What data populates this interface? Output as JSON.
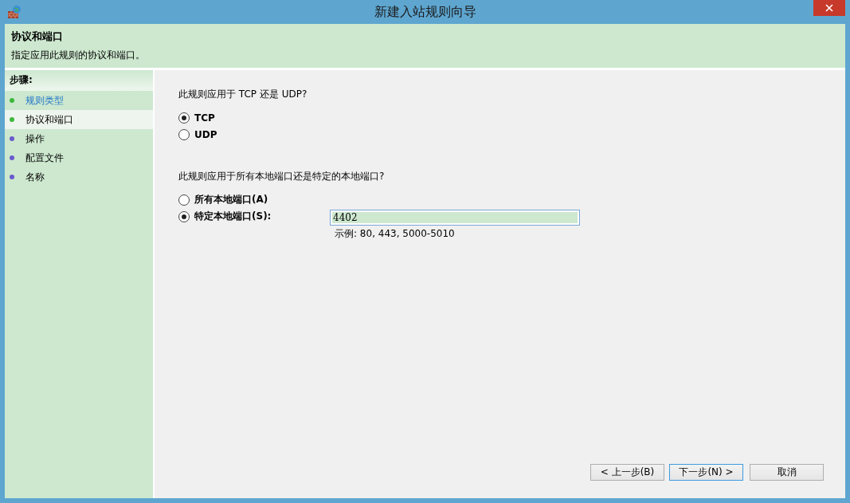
{
  "window": {
    "title": "新建入站规则向导"
  },
  "header": {
    "title": "协议和端口",
    "subtitle": "指定应用此规则的协议和端口。"
  },
  "steps": {
    "title": "步骤:",
    "items": [
      {
        "label": "规则类型",
        "color": "#3cb83c",
        "selected": false,
        "link": true
      },
      {
        "label": "协议和端口",
        "color": "#3cb83c",
        "selected": true,
        "link": false
      },
      {
        "label": "操作",
        "color": "#6a5acd",
        "selected": false,
        "link": false
      },
      {
        "label": "配置文件",
        "color": "#6a5acd",
        "selected": false,
        "link": false
      },
      {
        "label": "名称",
        "color": "#6a5acd",
        "selected": false,
        "link": false
      }
    ]
  },
  "protocol": {
    "question": "此规则应用于 TCP 还是 UDP?",
    "options": [
      {
        "label": "TCP",
        "selected": true
      },
      {
        "label": "UDP",
        "selected": false
      }
    ]
  },
  "ports": {
    "question": "此规则应用于所有本地端口还是特定的本地端口?",
    "options": [
      {
        "label": "所有本地端口(A)",
        "selected": false
      },
      {
        "label": "特定本地端口(S):",
        "selected": true
      }
    ],
    "field": {
      "value": "4402"
    },
    "example": "示例: 80, 443, 5000-5010"
  },
  "buttons": [
    {
      "label": "< 上一步(B)",
      "focused": false
    },
    {
      "label": "下一步(N) >",
      "focused": true
    },
    {
      "label": "取消",
      "focused": false
    }
  ]
}
